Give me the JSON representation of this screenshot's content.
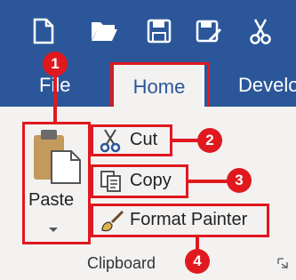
{
  "quick_access": {
    "icons": [
      "new-document-icon",
      "open-folder-icon",
      "save-icon",
      "save-as-icon",
      "cut-icon"
    ]
  },
  "tabs": {
    "file": "File",
    "home": "Home",
    "developer": "Develo"
  },
  "clipboard": {
    "paste_label": "Paste",
    "cut_label": "Cut",
    "copy_label": "Copy",
    "format_painter_label": "Format Painter",
    "group_label": "Clipboard"
  },
  "badges": {
    "one": "1",
    "two": "2",
    "three": "3",
    "four": "4"
  },
  "colors": {
    "title_bar": "#2b579a",
    "ribbon": "#f3f2f1",
    "highlight": "#e0191f"
  }
}
